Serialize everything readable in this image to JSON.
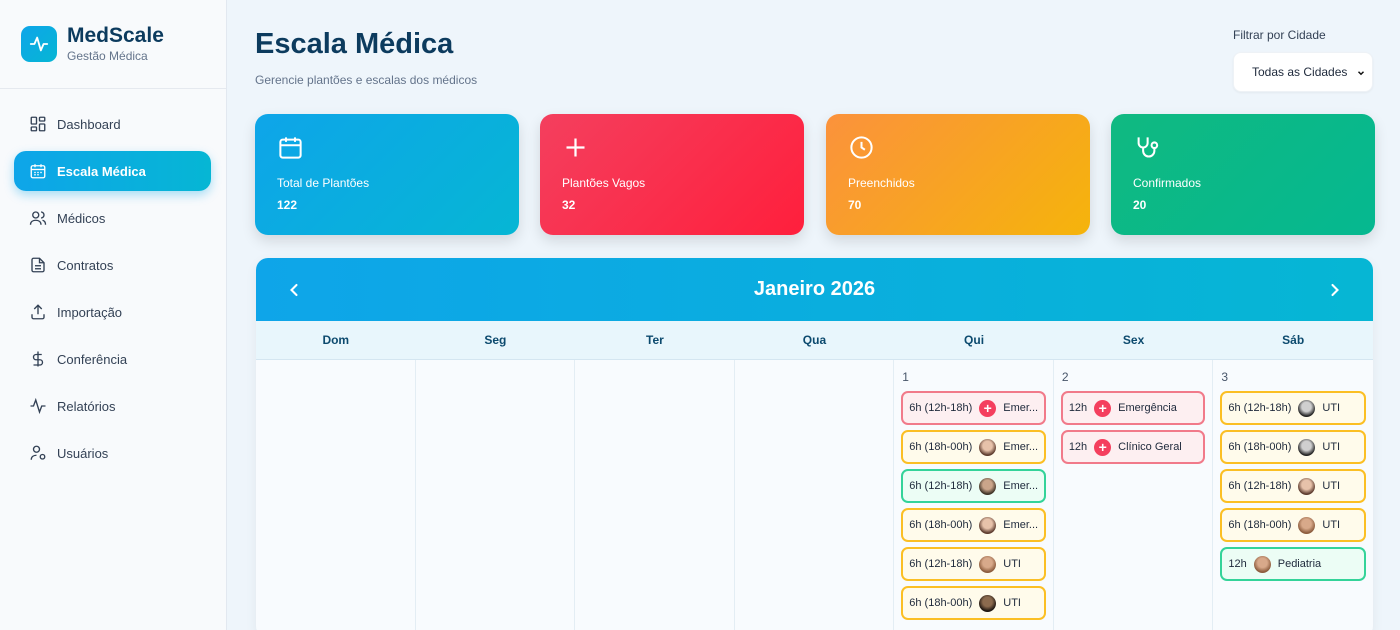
{
  "brand": {
    "name": "MedScale",
    "subtitle": "Gestão Médica"
  },
  "sidebar": {
    "items": [
      {
        "label": "Dashboard",
        "icon": "grid-icon",
        "active": false
      },
      {
        "label": "Escala Médica",
        "icon": "calendar-icon",
        "active": true
      },
      {
        "label": "Médicos",
        "icon": "users-icon",
        "active": false
      },
      {
        "label": "Contratos",
        "icon": "file-icon",
        "active": false
      },
      {
        "label": "Importação",
        "icon": "upload-icon",
        "active": false
      },
      {
        "label": "Conferência",
        "icon": "dollar-icon",
        "active": false
      },
      {
        "label": "Relatórios",
        "icon": "activity-icon",
        "active": false
      },
      {
        "label": "Usuários",
        "icon": "user-settings-icon",
        "active": false
      }
    ]
  },
  "header": {
    "title": "Escala Médica",
    "subtitle": "Gerencie plantões e escalas dos médicos"
  },
  "filter": {
    "label": "Filtrar por Cidade",
    "selected": "Todas as Cidades"
  },
  "stats": [
    {
      "label": "Total de Plantões",
      "value": "122",
      "icon": "calendar-icon",
      "color": "#0ea5e9"
    },
    {
      "label": "Plantões Vagos",
      "value": "32",
      "icon": "plus-icon",
      "color": "#f43f5e"
    },
    {
      "label": "Preenchidos",
      "value": "70",
      "icon": "clock-icon",
      "color": "#f59e0b"
    },
    {
      "label": "Confirmados",
      "value": "20",
      "icon": "stethoscope-icon",
      "color": "#10b981"
    }
  ],
  "calendar": {
    "month": "Janeiro 2026",
    "weekdays": [
      "Dom",
      "Seg",
      "Ter",
      "Qua",
      "Qui",
      "Sex",
      "Sáb"
    ],
    "days": [
      {
        "num": "",
        "shifts": []
      },
      {
        "num": "",
        "shifts": []
      },
      {
        "num": "",
        "shifts": []
      },
      {
        "num": "",
        "shifts": []
      },
      {
        "num": "1",
        "shifts": [
          {
            "duration": "6h (12h-18h)",
            "specialty": "Emer...",
            "status": "vago"
          },
          {
            "duration": "6h (18h-00h)",
            "specialty": "Emer...",
            "status": "pend",
            "avatar": "av3"
          },
          {
            "duration": "6h (12h-18h)",
            "specialty": "Emer...",
            "status": "conf",
            "avatar": "av2"
          },
          {
            "duration": "6h (18h-00h)",
            "specialty": "Emer...",
            "status": "pend",
            "avatar": "av3"
          },
          {
            "duration": "6h (12h-18h)",
            "specialty": "UTI",
            "status": "pend",
            "avatar": "av4"
          },
          {
            "duration": "6h (18h-00h)",
            "specialty": "UTI",
            "status": "pend",
            "avatar": "av5"
          }
        ]
      },
      {
        "num": "2",
        "shifts": [
          {
            "duration": "12h",
            "specialty": "Emergência",
            "status": "vago"
          },
          {
            "duration": "12h",
            "specialty": "Clínico Geral",
            "status": "vago"
          }
        ]
      },
      {
        "num": "3",
        "shifts": [
          {
            "duration": "6h (12h-18h)",
            "specialty": "UTI",
            "status": "pend",
            "avatar": "av6"
          },
          {
            "duration": "6h (18h-00h)",
            "specialty": "UTI",
            "status": "pend",
            "avatar": "av6"
          },
          {
            "duration": "6h (12h-18h)",
            "specialty": "UTI",
            "status": "pend",
            "avatar": "av3"
          },
          {
            "duration": "6h (18h-00h)",
            "specialty": "UTI",
            "status": "pend",
            "avatar": "av4"
          },
          {
            "duration": "12h",
            "specialty": "Pediatria",
            "status": "conf",
            "avatar": "av4"
          }
        ]
      }
    ]
  }
}
